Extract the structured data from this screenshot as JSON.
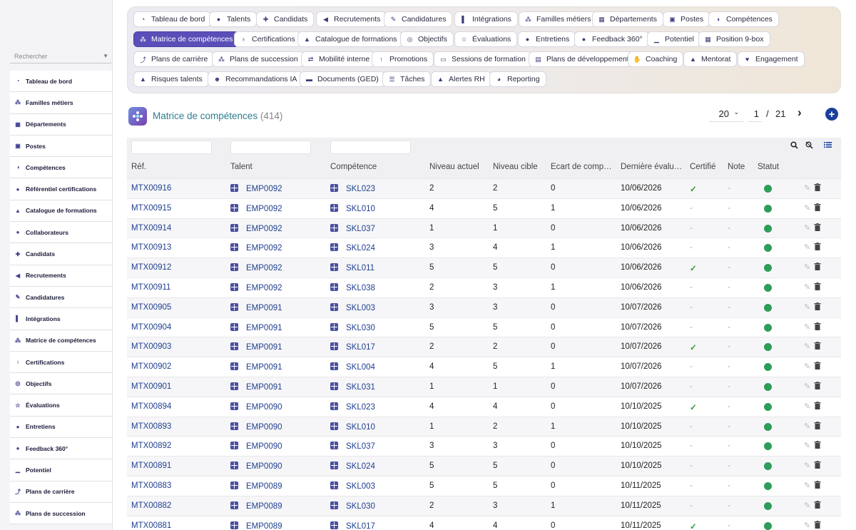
{
  "sidebar": {
    "search_placeholder": "Rechercher",
    "items": [
      {
        "label": "Tableau de bord",
        "icon": "dashboard-icon"
      },
      {
        "label": "Familles métiers",
        "icon": "sitemap-icon"
      },
      {
        "label": "Départements",
        "icon": "building-icon"
      },
      {
        "label": "Postes",
        "icon": "id-card-icon"
      },
      {
        "label": "Compétences",
        "icon": "brain-icon"
      },
      {
        "label": "Référentiel certifications",
        "icon": "certificate-icon"
      },
      {
        "label": "Catalogue de formations",
        "icon": "graduation-cap-icon"
      },
      {
        "label": "Collaborateurs",
        "icon": "user-icon"
      },
      {
        "label": "Candidats",
        "icon": "user-plus-icon"
      },
      {
        "label": "Recrutements",
        "icon": "megaphone-icon"
      },
      {
        "label": "Candidatures",
        "icon": "file-edit-icon"
      },
      {
        "label": "Intégrations",
        "icon": "door-icon"
      },
      {
        "label": "Matrice de compétences",
        "icon": "matrix-icon"
      },
      {
        "label": "Certifications",
        "icon": "award-icon"
      },
      {
        "label": "Objectifs",
        "icon": "target-icon"
      },
      {
        "label": "Évaluations",
        "icon": "star-icon"
      },
      {
        "label": "Entretiens",
        "icon": "comments-icon"
      },
      {
        "label": "Feedback 360°",
        "icon": "comment-icon"
      },
      {
        "label": "Potentiel",
        "icon": "chart-icon"
      },
      {
        "label": "Plans de carrière",
        "icon": "route-icon"
      },
      {
        "label": "Plans de succession",
        "icon": "sitemap-icon"
      }
    ]
  },
  "nav_chips": [
    {
      "label": "Tableau de bord",
      "icon": "dashboard-icon",
      "glyph": "◔"
    },
    {
      "label": "Talents",
      "icon": "user-icon",
      "glyph": "●"
    },
    {
      "label": "Candidats",
      "icon": "user-plus-icon",
      "glyph": "✚"
    },
    {
      "label": "Recrutements",
      "icon": "megaphone-icon",
      "glyph": "◀"
    },
    {
      "label": "Candidatures",
      "icon": "file-edit-icon",
      "glyph": "✎"
    },
    {
      "label": "Intégrations",
      "icon": "door-icon",
      "glyph": "▌"
    },
    {
      "label": "Familles métiers",
      "icon": "sitemap-icon",
      "glyph": "⁂"
    },
    {
      "label": "Départements",
      "icon": "building-icon",
      "glyph": "▦"
    },
    {
      "label": "Postes",
      "icon": "id-card-icon",
      "glyph": "▣"
    },
    {
      "label": "Compétences",
      "icon": "brain-icon",
      "glyph": "◑"
    },
    {
      "label": "Matrice de compétences",
      "icon": "matrix-icon",
      "glyph": "⁂",
      "active": true
    },
    {
      "label": "Certifications",
      "icon": "award-icon",
      "glyph": "♁"
    },
    {
      "label": "Catalogue de formations",
      "icon": "graduation-cap-icon",
      "glyph": "▲"
    },
    {
      "label": "Objectifs",
      "icon": "target-icon",
      "glyph": "◎"
    },
    {
      "label": "Évaluations",
      "icon": "star-icon",
      "glyph": "☆"
    },
    {
      "label": "Entretiens",
      "icon": "comments-icon",
      "glyph": "●"
    },
    {
      "label": "Feedback 360°",
      "icon": "comment-icon",
      "glyph": "●"
    },
    {
      "label": "Potentiel",
      "icon": "chart-icon",
      "glyph": "▁"
    },
    {
      "label": "Position 9-box",
      "icon": "grid-icon",
      "glyph": "▦"
    },
    {
      "label": "Plans de carrière",
      "icon": "route-icon",
      "glyph": "⤴"
    },
    {
      "label": "Plans de succession",
      "icon": "sitemap-icon",
      "glyph": "⁂"
    },
    {
      "label": "Mobilité interne",
      "icon": "exchange-icon",
      "glyph": "⇄"
    },
    {
      "label": "Promotions",
      "icon": "arrow-up-icon",
      "glyph": "↑"
    },
    {
      "label": "Sessions de formation",
      "icon": "chalkboard-icon",
      "glyph": "▭"
    },
    {
      "label": "Plans de développement",
      "icon": "clipboard-icon",
      "glyph": "▤"
    },
    {
      "label": "Coaching",
      "icon": "handshake-icon",
      "glyph": "✋"
    },
    {
      "label": "Mentorat",
      "icon": "mentor-icon",
      "glyph": "▲"
    },
    {
      "label": "Engagement",
      "icon": "heart-icon",
      "glyph": "♥"
    },
    {
      "label": "Risques talents",
      "icon": "warning-icon",
      "glyph": "▲"
    },
    {
      "label": "Recommandations IA",
      "icon": "robot-icon",
      "glyph": "☻"
    },
    {
      "label": "Documents (GED)",
      "icon": "folder-icon",
      "glyph": "▬"
    },
    {
      "label": "Tâches",
      "icon": "tasks-icon",
      "glyph": "☰"
    },
    {
      "label": "Alertes RH",
      "icon": "bell-icon",
      "glyph": "▲"
    },
    {
      "label": "Reporting",
      "icon": "pie-chart-icon",
      "glyph": "◕"
    }
  ],
  "header": {
    "title": "Matrice de compétences",
    "count": "(414)",
    "page_size": "20",
    "page": "1",
    "slash": "/",
    "total_pages": "21",
    "next": "›",
    "add": "+"
  },
  "table": {
    "columns": [
      "Réf.",
      "Talent",
      "Compétence",
      "Niveau actuel",
      "Niveau cible",
      "Écart de comp…",
      "Dernière évalu…",
      "Certifié",
      "Note",
      "Statut"
    ],
    "rows": [
      {
        "ref": "MTX00916",
        "talent": "EMP0092",
        "skill": "SKL023",
        "current": "2",
        "target": "2",
        "gap": "0",
        "date": "10/06/2026",
        "certified": true,
        "note": "-",
        "status": "active"
      },
      {
        "ref": "MTX00915",
        "talent": "EMP0092",
        "skill": "SKL010",
        "current": "4",
        "target": "5",
        "gap": "1",
        "date": "10/06/2026",
        "certified": false,
        "note": "-",
        "status": "active"
      },
      {
        "ref": "MTX00914",
        "talent": "EMP0092",
        "skill": "SKL037",
        "current": "1",
        "target": "1",
        "gap": "0",
        "date": "10/06/2026",
        "certified": false,
        "note": "-",
        "status": "active"
      },
      {
        "ref": "MTX00913",
        "talent": "EMP0092",
        "skill": "SKL024",
        "current": "3",
        "target": "4",
        "gap": "1",
        "date": "10/06/2026",
        "certified": false,
        "note": "-",
        "status": "active"
      },
      {
        "ref": "MTX00912",
        "talent": "EMP0092",
        "skill": "SKL011",
        "current": "5",
        "target": "5",
        "gap": "0",
        "date": "10/06/2026",
        "certified": true,
        "note": "-",
        "status": "active"
      },
      {
        "ref": "MTX00911",
        "talent": "EMP0092",
        "skill": "SKL038",
        "current": "2",
        "target": "3",
        "gap": "1",
        "date": "10/06/2026",
        "certified": false,
        "note": "-",
        "status": "active"
      },
      {
        "ref": "MTX00905",
        "talent": "EMP0091",
        "skill": "SKL003",
        "current": "3",
        "target": "3",
        "gap": "0",
        "date": "10/07/2026",
        "certified": false,
        "note": "-",
        "status": "active"
      },
      {
        "ref": "MTX00904",
        "talent": "EMP0091",
        "skill": "SKL030",
        "current": "5",
        "target": "5",
        "gap": "0",
        "date": "10/07/2026",
        "certified": false,
        "note": "-",
        "status": "active"
      },
      {
        "ref": "MTX00903",
        "talent": "EMP0091",
        "skill": "SKL017",
        "current": "2",
        "target": "2",
        "gap": "0",
        "date": "10/07/2026",
        "certified": true,
        "note": "-",
        "status": "active"
      },
      {
        "ref": "MTX00902",
        "talent": "EMP0091",
        "skill": "SKL004",
        "current": "4",
        "target": "5",
        "gap": "1",
        "date": "10/07/2026",
        "certified": false,
        "note": "-",
        "status": "active"
      },
      {
        "ref": "MTX00901",
        "talent": "EMP0091",
        "skill": "SKL031",
        "current": "1",
        "target": "1",
        "gap": "0",
        "date": "10/07/2026",
        "certified": false,
        "note": "-",
        "status": "active"
      },
      {
        "ref": "MTX00894",
        "talent": "EMP0090",
        "skill": "SKL023",
        "current": "4",
        "target": "4",
        "gap": "0",
        "date": "10/10/2025",
        "certified": true,
        "note": "-",
        "status": "active"
      },
      {
        "ref": "MTX00893",
        "talent": "EMP0090",
        "skill": "SKL010",
        "current": "1",
        "target": "2",
        "gap": "1",
        "date": "10/10/2025",
        "certified": false,
        "note": "-",
        "status": "active"
      },
      {
        "ref": "MTX00892",
        "talent": "EMP0090",
        "skill": "SKL037",
        "current": "3",
        "target": "3",
        "gap": "0",
        "date": "10/10/2025",
        "certified": false,
        "note": "-",
        "status": "active"
      },
      {
        "ref": "MTX00891",
        "talent": "EMP0090",
        "skill": "SKL024",
        "current": "5",
        "target": "5",
        "gap": "0",
        "date": "10/10/2025",
        "certified": false,
        "note": "-",
        "status": "active"
      },
      {
        "ref": "MTX00883",
        "talent": "EMP0089",
        "skill": "SKL003",
        "current": "5",
        "target": "5",
        "gap": "0",
        "date": "10/11/2025",
        "certified": false,
        "note": "-",
        "status": "active"
      },
      {
        "ref": "MTX00882",
        "talent": "EMP0089",
        "skill": "SKL030",
        "current": "2",
        "target": "3",
        "gap": "1",
        "date": "10/11/2025",
        "certified": false,
        "note": "-",
        "status": "active"
      },
      {
        "ref": "MTX00881",
        "talent": "EMP0089",
        "skill": "SKL017",
        "current": "4",
        "target": "4",
        "gap": "0",
        "date": "10/11/2025",
        "certified": true,
        "note": "-",
        "status": "active"
      }
    ]
  },
  "colors": {
    "accent": "#5a4fb8",
    "link": "#1f3f8f",
    "title": "#2f7f8f",
    "status_active": "#2e9d5a",
    "check": "#2e9d3a"
  }
}
